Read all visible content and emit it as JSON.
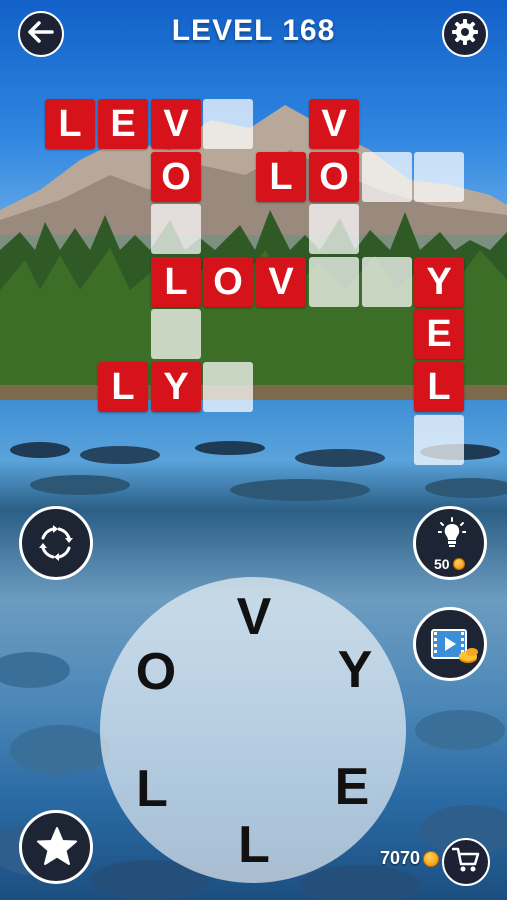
{
  "header": {
    "level_label": "LEVEL 168",
    "back_icon": "back-arrow-icon",
    "settings_icon": "gear-icon"
  },
  "board": {
    "cells": [
      {
        "letter": "L",
        "state": "filled"
      },
      {
        "letter": "E",
        "state": "filled"
      },
      {
        "letter": "V",
        "state": "filled"
      },
      {
        "letter": "",
        "state": "empty"
      },
      {
        "letter": "V",
        "state": "filled"
      },
      {
        "letter": "O",
        "state": "filled"
      },
      {
        "letter": "L",
        "state": "filled"
      },
      {
        "letter": "O",
        "state": "filled"
      },
      {
        "letter": "",
        "state": "empty"
      },
      {
        "letter": "",
        "state": "empty"
      },
      {
        "letter": "",
        "state": "empty"
      },
      {
        "letter": "",
        "state": "empty"
      },
      {
        "letter": "L",
        "state": "filled"
      },
      {
        "letter": "O",
        "state": "filled"
      },
      {
        "letter": "V",
        "state": "filled"
      },
      {
        "letter": "",
        "state": "empty"
      },
      {
        "letter": "",
        "state": "empty"
      },
      {
        "letter": "Y",
        "state": "filled"
      },
      {
        "letter": "",
        "state": "empty"
      },
      {
        "letter": "E",
        "state": "filled"
      },
      {
        "letter": "L",
        "state": "filled"
      },
      {
        "letter": "Y",
        "state": "filled"
      },
      {
        "letter": "",
        "state": "empty"
      },
      {
        "letter": "L",
        "state": "filled"
      },
      {
        "letter": "",
        "state": "empty"
      }
    ]
  },
  "wheel": {
    "letters": [
      "V",
      "Y",
      "E",
      "L",
      "L",
      "O"
    ]
  },
  "hint": {
    "cost": "50",
    "icon": "lightbulb-icon"
  },
  "video": {
    "icon": "video-reward-icon"
  },
  "shuffle": {
    "icon": "shuffle-icon"
  },
  "star": {
    "icon": "star-icon"
  },
  "wallet": {
    "coins": "7070",
    "shop_icon": "shopping-cart-icon"
  },
  "colors": {
    "tile_red": "#d6121a",
    "tile_empty": "#ffffff",
    "button_dark": "#1c2233",
    "coin_gold": "#f5a623"
  }
}
